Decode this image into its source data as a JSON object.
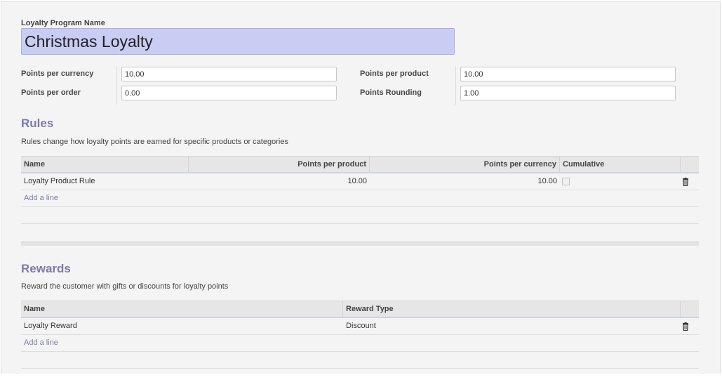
{
  "program": {
    "name_label": "Loyalty Program Name",
    "name_value": "Christmas Loyalty"
  },
  "settings": {
    "points_per_currency": {
      "label": "Points per currency",
      "value": "10.00"
    },
    "points_per_order": {
      "label": "Points per order",
      "value": "0.00"
    },
    "points_per_product": {
      "label": "Points per product",
      "value": "10.00"
    },
    "points_rounding": {
      "label": "Points Rounding",
      "value": "1.00"
    }
  },
  "rules": {
    "title": "Rules",
    "description": "Rules change how loyalty points are earned for specific products or categories",
    "columns": [
      "Name",
      "Points per product",
      "Points per currency",
      "Cumulative"
    ],
    "rows": [
      {
        "name": "Loyalty Product Rule",
        "points_per_product": "10.00",
        "points_per_currency": "10.00",
        "cumulative": false
      }
    ],
    "add_line": "Add a line"
  },
  "rewards": {
    "title": "Rewards",
    "description": "Reward the customer with gifts or discounts for loyalty points",
    "columns": [
      "Name",
      "Reward Type"
    ],
    "rows": [
      {
        "name": "Loyalty Reward",
        "reward_type": "Discount"
      }
    ],
    "add_line": "Add a line"
  },
  "icons": {
    "delete": "trash-icon"
  },
  "colors": {
    "accent": "#7c7bad",
    "name_field_bg": "#c9cdf3"
  }
}
